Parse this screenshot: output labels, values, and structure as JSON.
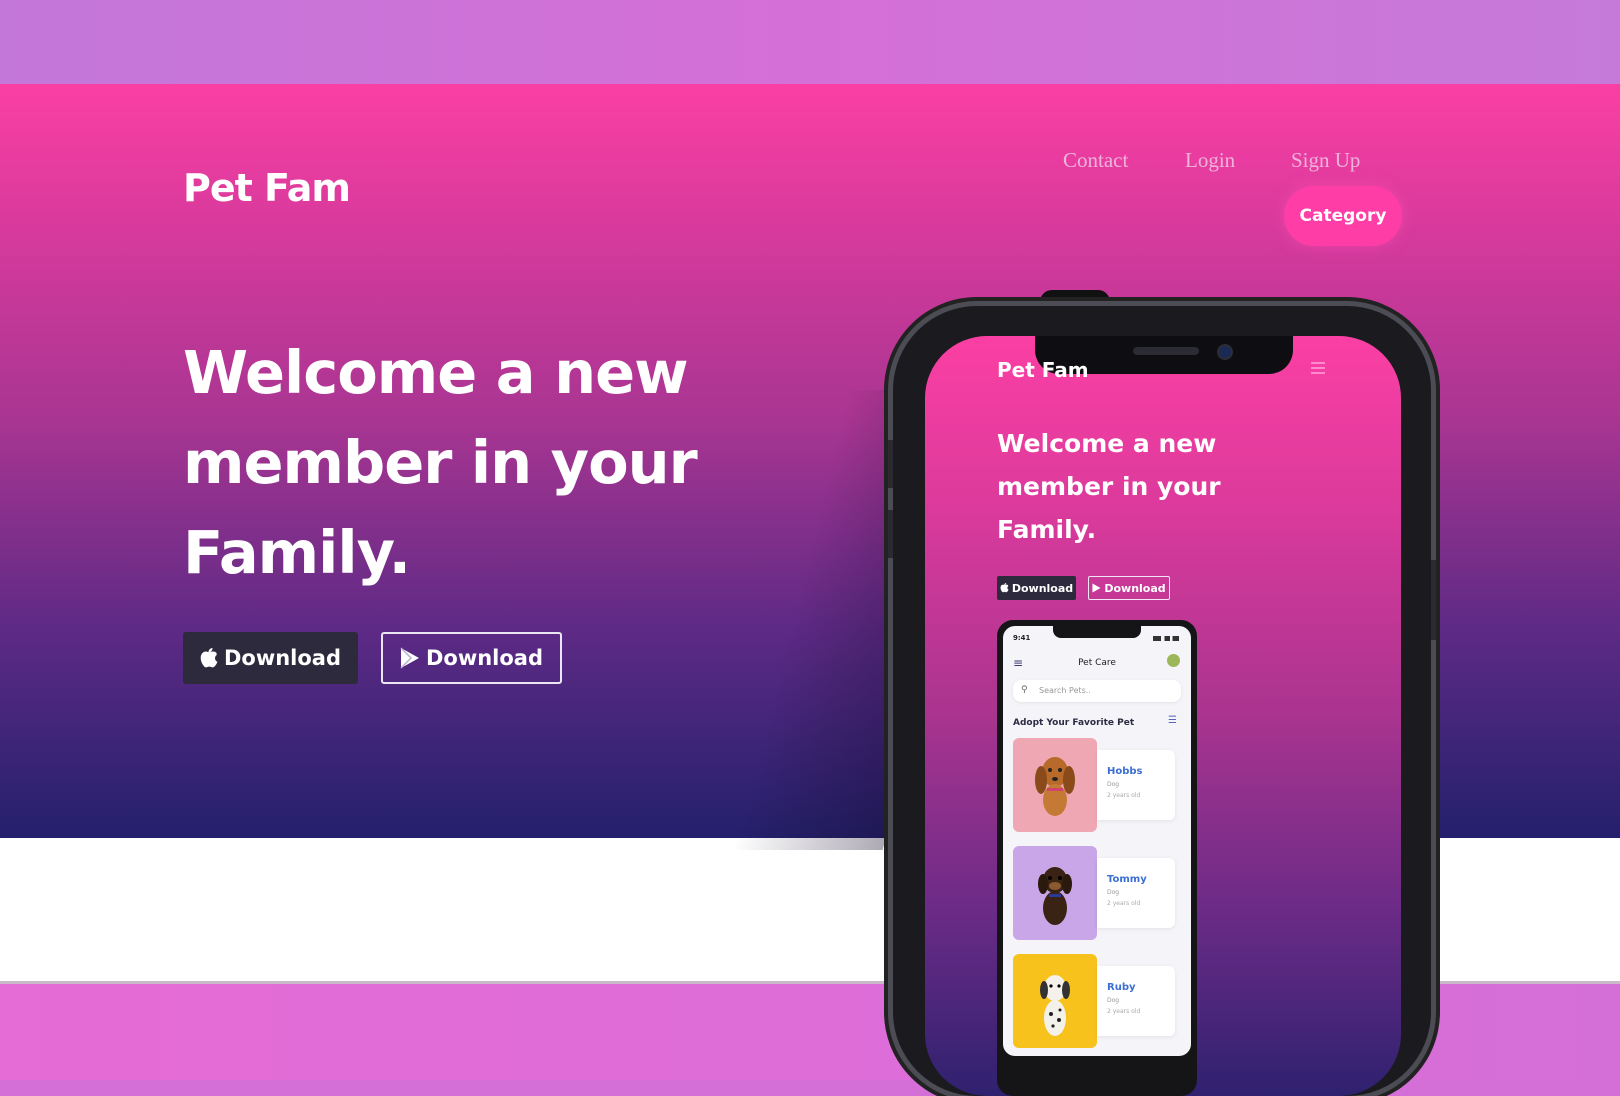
{
  "site": {
    "brand": "Pet Fam",
    "nav": {
      "contact": "Contact",
      "login": "Login",
      "signup": "Sign Up",
      "category": "Category"
    },
    "hero": {
      "headline": "Welcome a new member in your Family.",
      "download_apple": "Download",
      "download_play": "Download"
    }
  },
  "phone": {
    "brand": "Pet Fam",
    "headline": "Welcome a new member in your Family.",
    "download_apple": "Download",
    "download_play": "Download",
    "app": {
      "time": "9:41",
      "title": "Pet Care",
      "search_placeholder": "Search Pets..",
      "section_title": "Adopt Your Favorite Pet",
      "pets": [
        {
          "name": "Hobbs",
          "type": "Dog",
          "age": "2 years old",
          "bg": "#f0a7b4"
        },
        {
          "name": "Tommy",
          "type": "Dog",
          "age": "2 years old",
          "bg": "#c8a6e8"
        },
        {
          "name": "Ruby",
          "type": "Dog",
          "age": "2 years old",
          "bg": "#f8c21c"
        }
      ]
    }
  },
  "colors": {
    "accent_pink": "#ff3da7",
    "hero_top": "#fb3fa4",
    "hero_bottom": "#24206c",
    "pet_name_blue": "#3b6fd4"
  }
}
